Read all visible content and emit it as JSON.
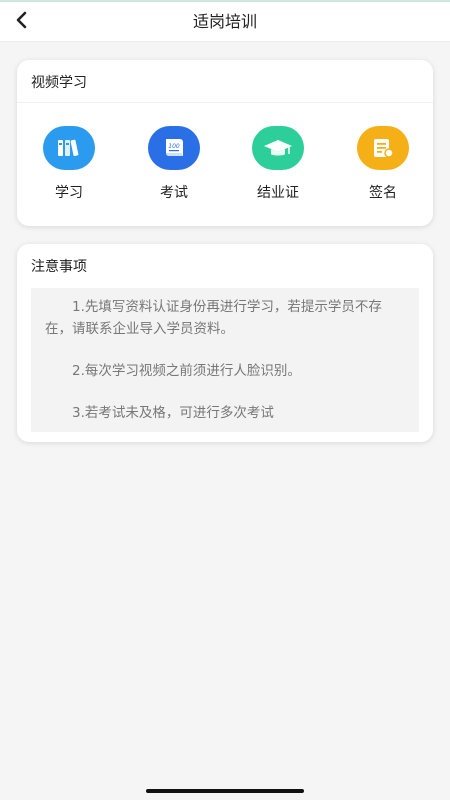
{
  "header": {
    "title": "适岗培训",
    "back_icon": "chevron-left-icon"
  },
  "video_section": {
    "title": "视频学习",
    "items": [
      {
        "label": "学习",
        "icon": "books-icon",
        "color": "#2b9bef"
      },
      {
        "label": "考试",
        "icon": "exam-paper-icon",
        "color": "#2a6fe6"
      },
      {
        "label": "结业证",
        "icon": "graduation-cap-icon",
        "color": "#2ccf9a"
      },
      {
        "label": "签名",
        "icon": "certificate-sign-icon",
        "color": "#f5b018"
      }
    ]
  },
  "notes_section": {
    "title": "注意事项",
    "items": [
      "1.先填写资料认证身份再进行学习，若提示学员不存在，请联系企业导入学员资料。",
      "2.每次学习视频之前须进行人脸识别。",
      "3.若考试未及格，可进行多次考试"
    ]
  }
}
